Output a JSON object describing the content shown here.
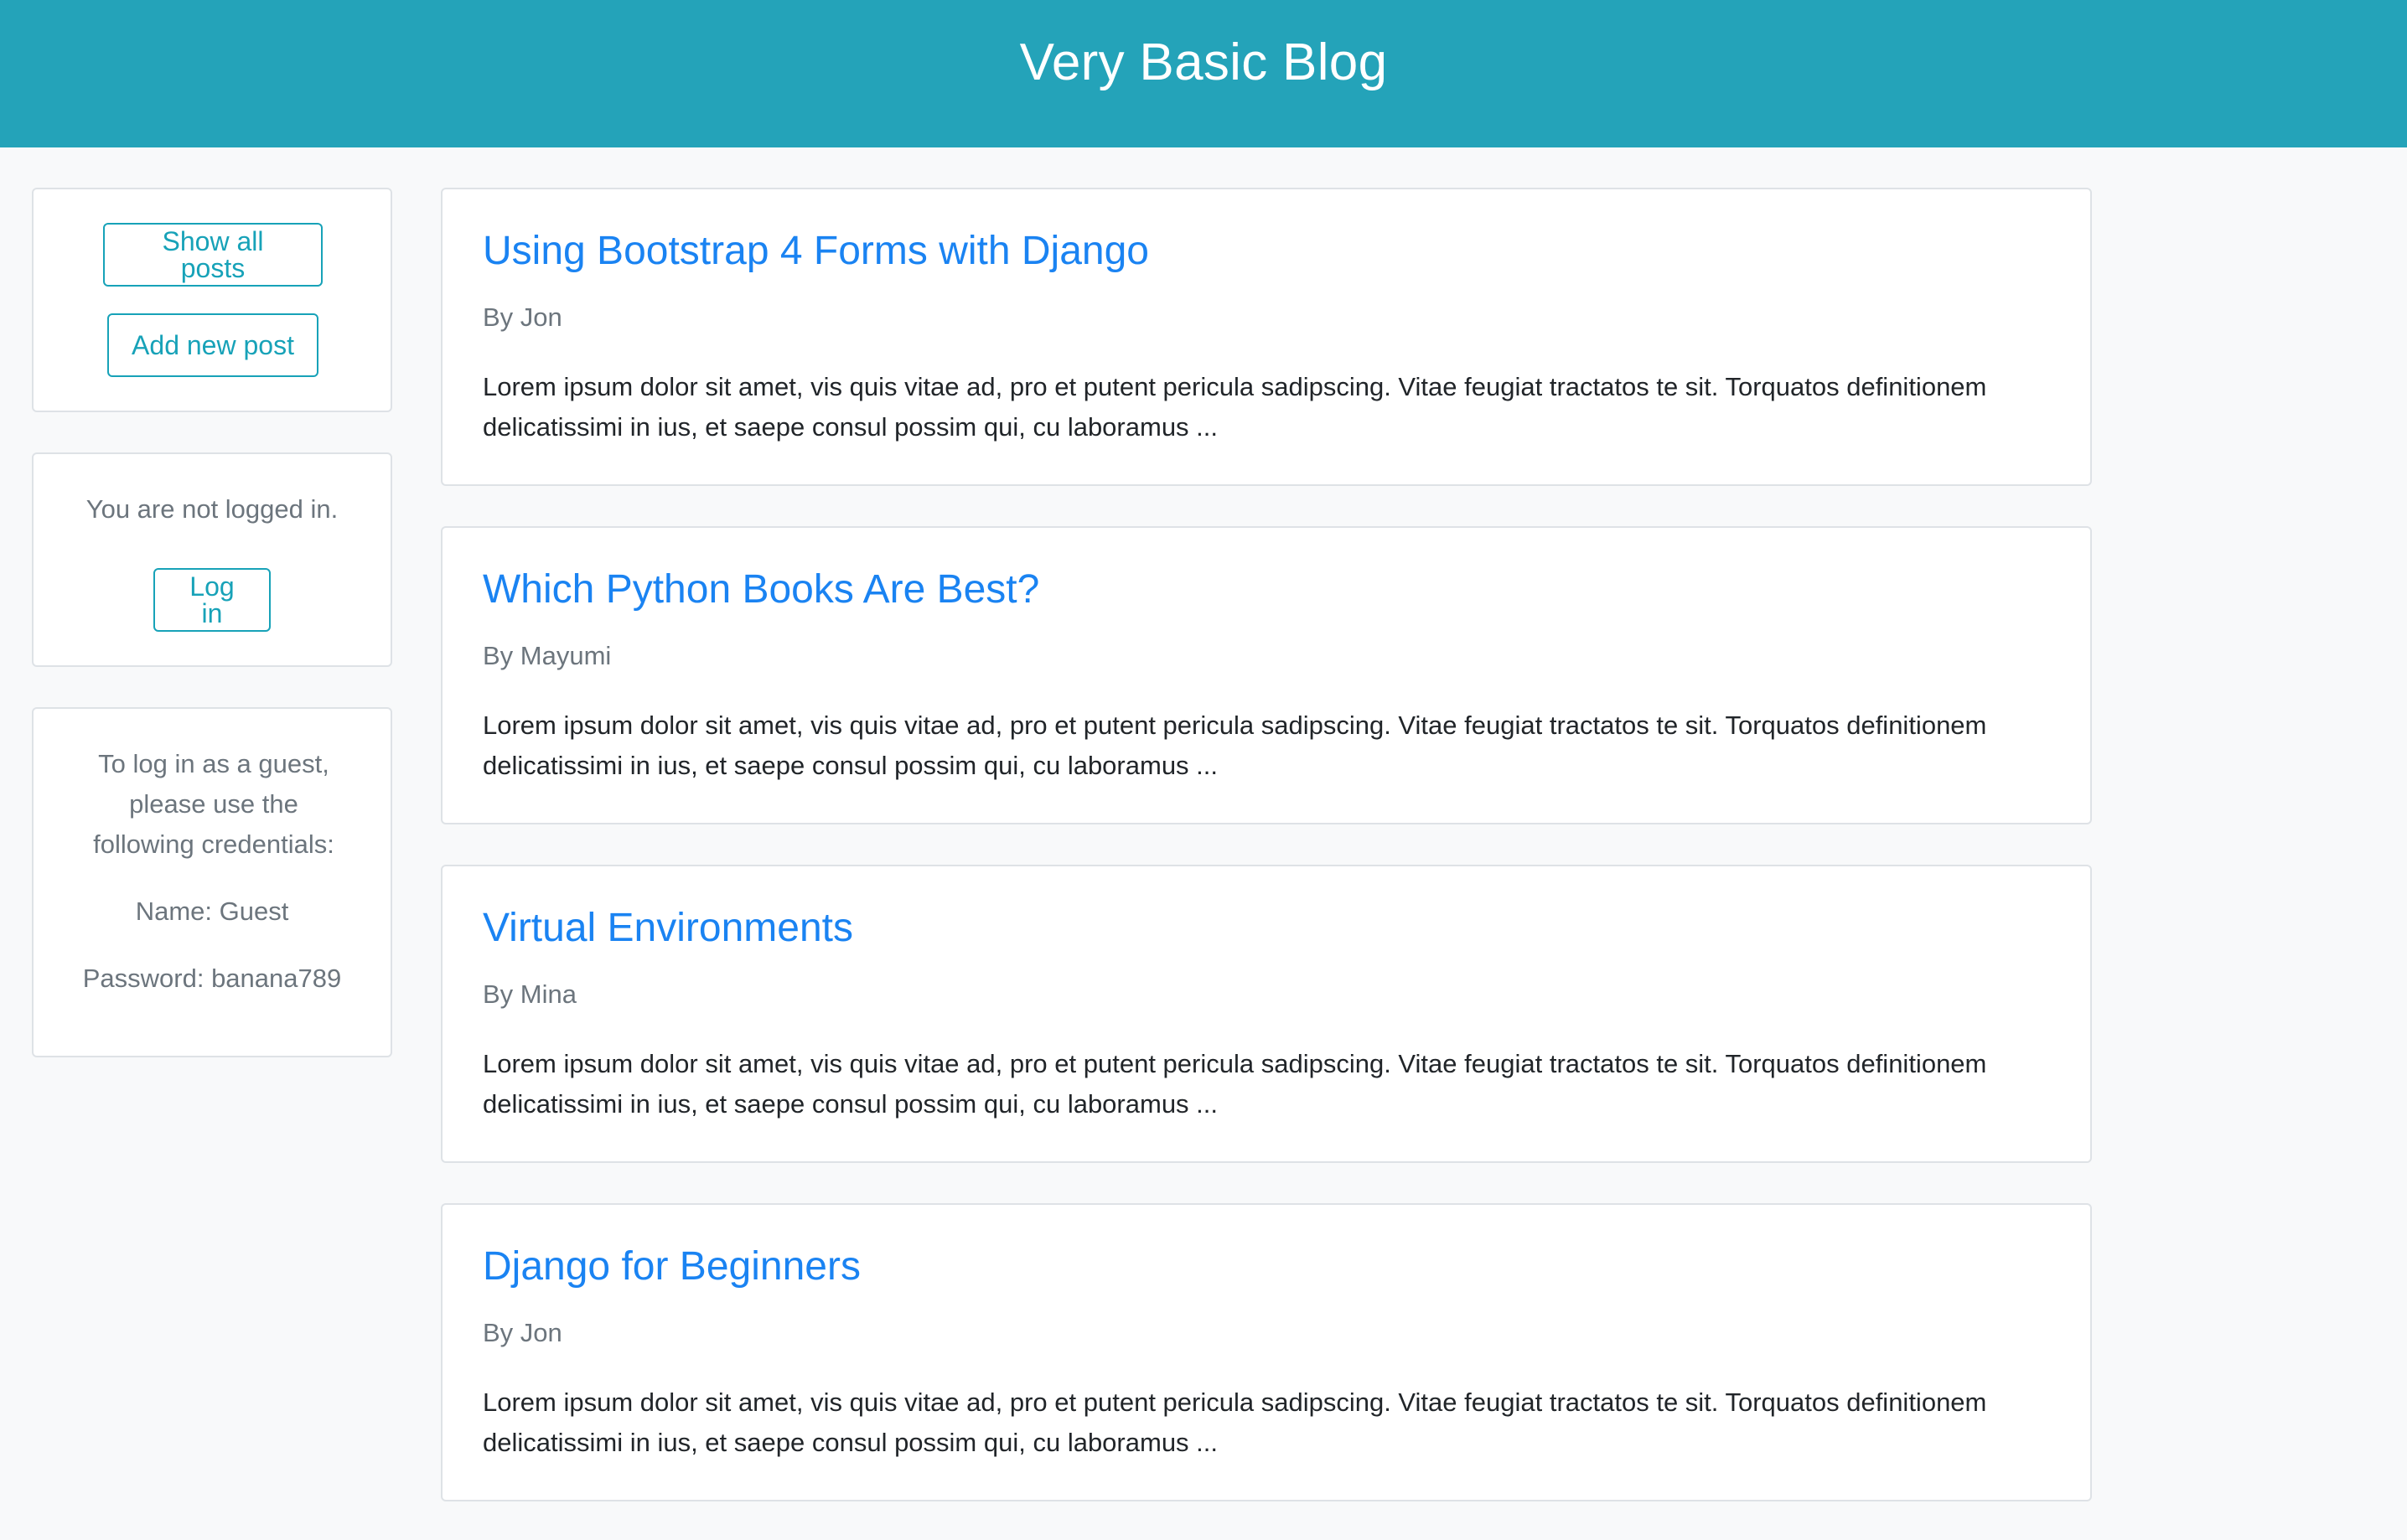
{
  "header": {
    "title": "Very Basic Blog"
  },
  "sidebar": {
    "nav": {
      "show_all_label": "Show all posts",
      "add_new_label": "Add new post"
    },
    "auth": {
      "status_text": "You are not logged in.",
      "login_label": "Log in"
    },
    "guest": {
      "intro": "To log in as a guest, please use the following credentials:",
      "name": "Name: Guest",
      "password": "Password: banana789"
    }
  },
  "posts": [
    {
      "title": "Using Bootstrap 4 Forms with Django",
      "author": "By Jon",
      "excerpt": "Lorem ipsum dolor sit amet, vis quis vitae ad, pro et putent pericula sadipscing. Vitae feugiat tractatos te sit. Torquatos definitionem delicatissimi in ius, et saepe consul possim qui, cu laboramus ..."
    },
    {
      "title": "Which Python Books Are Best?",
      "author": "By Mayumi",
      "excerpt": "Lorem ipsum dolor sit amet, vis quis vitae ad, pro et putent pericula sadipscing. Vitae feugiat tractatos te sit. Torquatos definitionem delicatissimi in ius, et saepe consul possim qui, cu laboramus ..."
    },
    {
      "title": "Virtual Environments",
      "author": "By Mina",
      "excerpt": "Lorem ipsum dolor sit amet, vis quis vitae ad, pro et putent pericula sadipscing. Vitae feugiat tractatos te sit. Torquatos definitionem delicatissimi in ius, et saepe consul possim qui, cu laboramus ..."
    },
    {
      "title": "Django for Beginners",
      "author": "By Jon",
      "excerpt": "Lorem ipsum dolor sit amet, vis quis vitae ad, pro et putent pericula sadipscing. Vitae feugiat tractatos te sit. Torquatos definitionem delicatissimi in ius, et saepe consul possim qui, cu laboramus ..."
    }
  ],
  "colors": {
    "header_bg": "#24a3b9",
    "link": "#1a83f2",
    "button_outline": "#17a2b8",
    "muted_text": "#6c757d",
    "body_text": "#212529",
    "page_bg": "#f8f9fa"
  }
}
